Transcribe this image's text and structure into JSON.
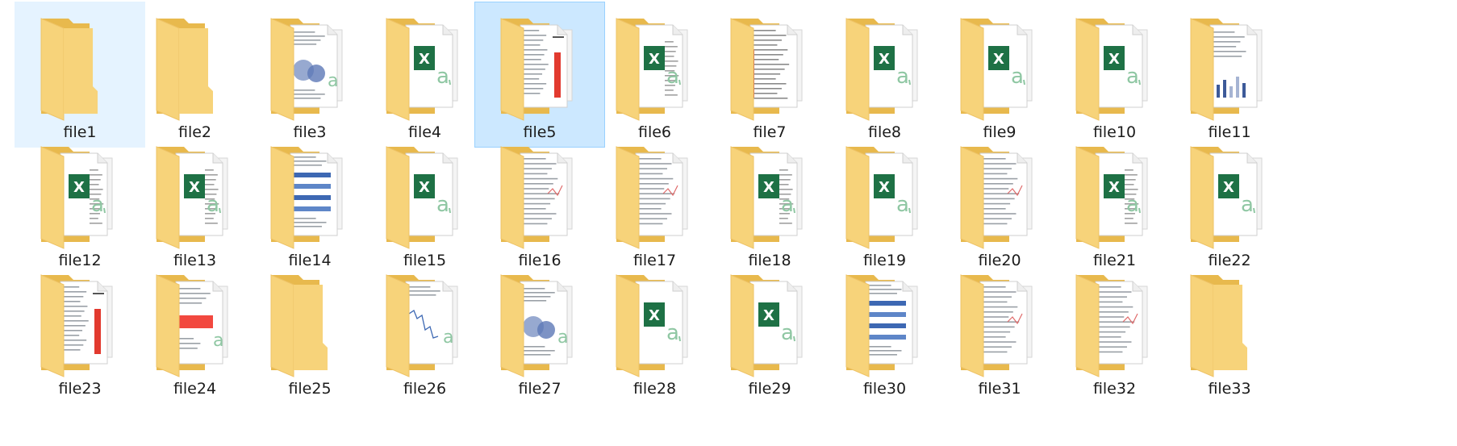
{
  "explorer": {
    "items": [
      {
        "name": "file1",
        "type": "empty",
        "selected": "hover"
      },
      {
        "name": "file2",
        "type": "empty"
      },
      {
        "name": "file3",
        "type": "doc-chart"
      },
      {
        "name": "file4",
        "type": "excel"
      },
      {
        "name": "file5",
        "type": "doc-bar",
        "selected": "selected"
      },
      {
        "name": "file6",
        "type": "excel-doc"
      },
      {
        "name": "file7",
        "type": "doc-table"
      },
      {
        "name": "file8",
        "type": "excel"
      },
      {
        "name": "file9",
        "type": "excel"
      },
      {
        "name": "file10",
        "type": "excel"
      },
      {
        "name": "file11",
        "type": "doc-bars"
      },
      {
        "name": "file12",
        "type": "excel-doc"
      },
      {
        "name": "file13",
        "type": "excel-doc"
      },
      {
        "name": "file14",
        "type": "doc-blue"
      },
      {
        "name": "file15",
        "type": "excel"
      },
      {
        "name": "file16",
        "type": "doc-text"
      },
      {
        "name": "file17",
        "type": "doc-text"
      },
      {
        "name": "file18",
        "type": "excel-doc"
      },
      {
        "name": "file19",
        "type": "excel"
      },
      {
        "name": "file20",
        "type": "doc-text"
      },
      {
        "name": "file21",
        "type": "excel-doc"
      },
      {
        "name": "file22",
        "type": "excel"
      },
      {
        "name": "file23",
        "type": "doc-bar"
      },
      {
        "name": "file24",
        "type": "doc-red-banner"
      },
      {
        "name": "file25",
        "type": "empty"
      },
      {
        "name": "file26",
        "type": "doc-line"
      },
      {
        "name": "file27",
        "type": "doc-chart"
      },
      {
        "name": "file28",
        "type": "excel"
      },
      {
        "name": "file29",
        "type": "excel"
      },
      {
        "name": "file30",
        "type": "doc-blue"
      },
      {
        "name": "file31",
        "type": "doc-text"
      },
      {
        "name": "file32",
        "type": "doc-text"
      },
      {
        "name": "file33",
        "type": "empty"
      }
    ]
  },
  "colors": {
    "folder_back": "#e8b94d",
    "folder_front": "#f7d37a",
    "folder_front_edge": "#eec366",
    "excel_green": "#1e7145",
    "excel_a": "#8fc7a3",
    "selection_hover": "#e5f3ff",
    "selection_active": "#cce8ff",
    "selection_border": "#99d1ff"
  }
}
